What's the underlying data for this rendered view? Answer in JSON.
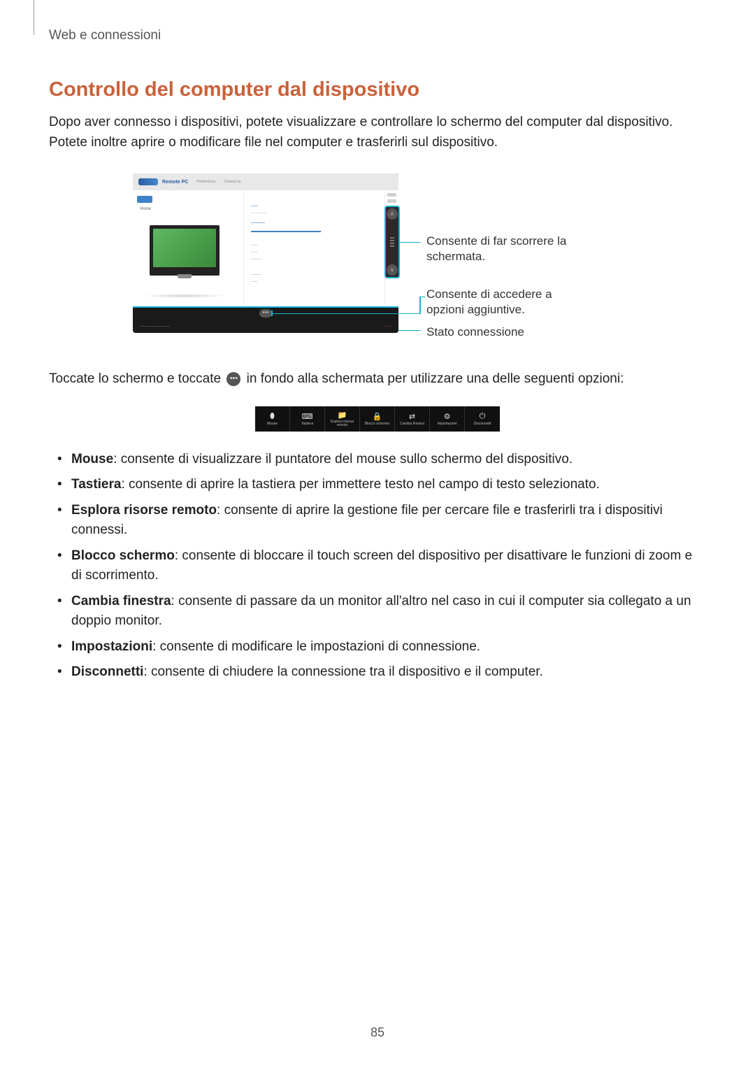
{
  "header": {
    "section": "Web e connessioni"
  },
  "title": "Controllo del computer dal dispositivo",
  "intro": "Dopo aver connesso i dispositivi, potete visualizzare e controllare lo schermo del computer dal dispositivo. Potete inoltre aprire o modificare file nel computer e trasferirli sul dispositivo.",
  "figure": {
    "app_title": "Remote PC",
    "menu1": "Preferences",
    "menu2": "Connect to",
    "side_label": "Home",
    "callouts": {
      "scroll": "Consente di far scorrere la schermata.",
      "options": "Consente di accedere a opzioni aggiuntive.",
      "status": "Stato connessione"
    }
  },
  "inline": {
    "before": "Toccate lo schermo e toccate",
    "after": "in fondo alla schermata per utilizzare una delle seguenti opzioni:"
  },
  "options_strip": [
    {
      "icon": "mouse",
      "label": "Mouse"
    },
    {
      "icon": "keyboard",
      "label": "Tastiera"
    },
    {
      "icon": "folder",
      "label": "Esplora risorse remoto"
    },
    {
      "icon": "lock",
      "label": "Blocco schermo"
    },
    {
      "icon": "swap",
      "label": "Cambia finestra"
    },
    {
      "icon": "gear",
      "label": "Impostazioni"
    },
    {
      "icon": "power",
      "label": "Disconnetti"
    }
  ],
  "features": [
    {
      "term": "Mouse",
      "desc": ": consente di visualizzare il puntatore del mouse sullo schermo del dispositivo."
    },
    {
      "term": "Tastiera",
      "desc": ": consente di aprire la tastiera per immettere testo nel campo di testo selezionato."
    },
    {
      "term": "Esplora risorse remoto",
      "desc": ": consente di aprire la gestione file per cercare file e trasferirli tra i dispositivi connessi."
    },
    {
      "term": "Blocco schermo",
      "desc": ": consente di bloccare il touch screen del dispositivo per disattivare le funzioni di zoom e di scorrimento."
    },
    {
      "term": "Cambia finestra",
      "desc": ": consente di passare da un monitor all'altro nel caso in cui il computer sia collegato a un doppio monitor."
    },
    {
      "term": "Impostazioni",
      "desc": ": consente di modificare le impostazioni di connessione."
    },
    {
      "term": "Disconnetti",
      "desc": ": consente di chiudere la connessione tra il dispositivo e il computer."
    }
  ],
  "page_number": "85",
  "icon_glyph": {
    "mouse": "⬮",
    "keyboard": "⌨",
    "folder": "📁",
    "lock": "🔒",
    "swap": "⇄",
    "gear": "⚙",
    "power": "⏻"
  }
}
